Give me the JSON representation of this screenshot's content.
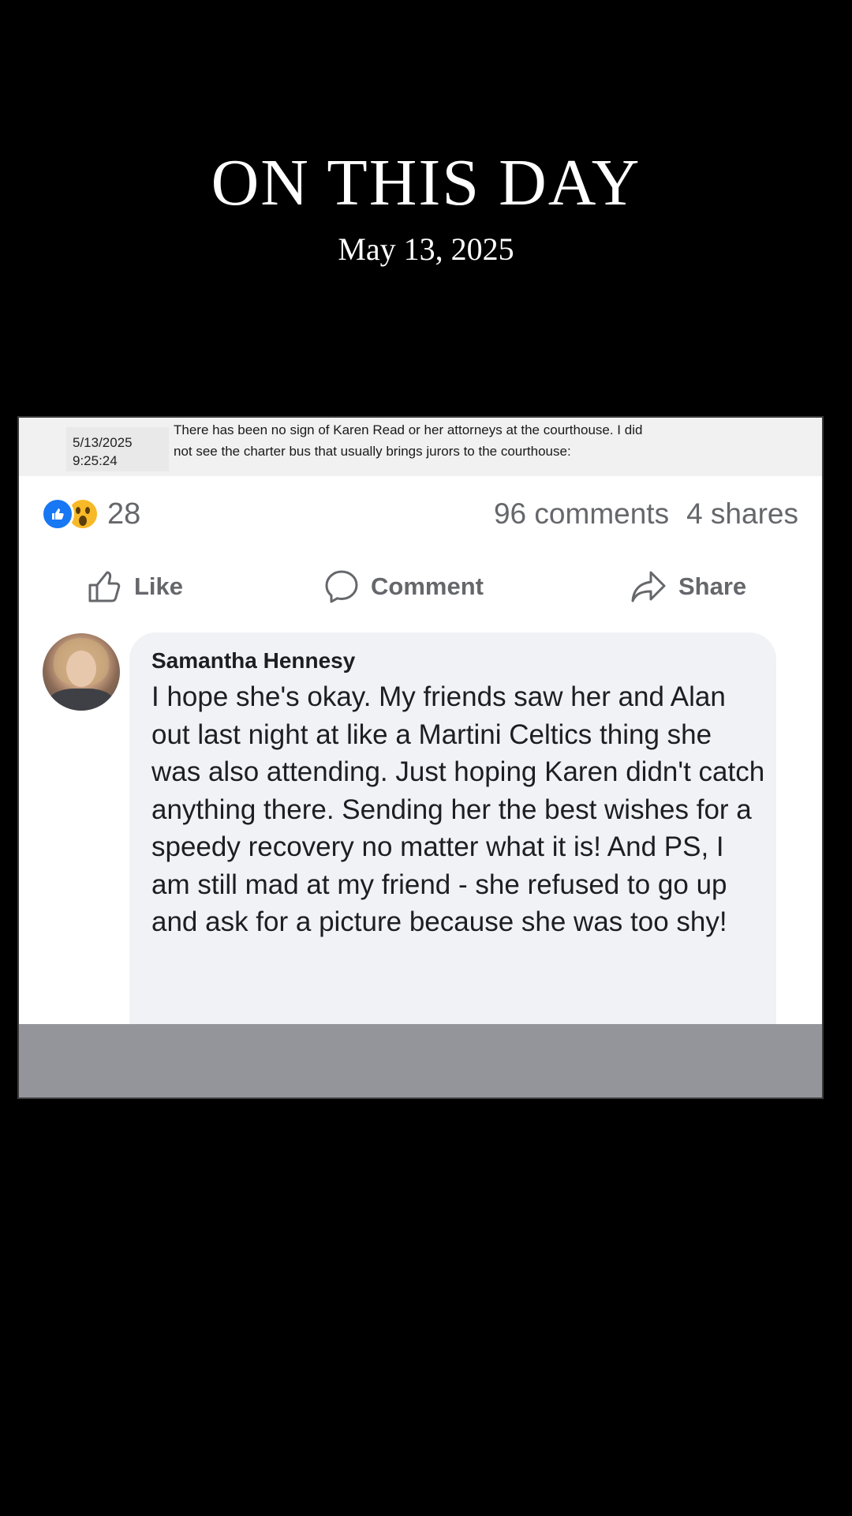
{
  "header": {
    "title": "ON THIS DAY",
    "date": "May 13, 2025"
  },
  "log": {
    "date": "5/13/2025",
    "time": "9:25:24",
    "text": "There has been no sign of Karen Read or her attorneys at the courthouse. I did not see the charter bus that usually brings jurors to the courthouse:"
  },
  "post": {
    "reactions": {
      "icons": [
        "like-reaction-icon",
        "wow-reaction-icon"
      ],
      "count": "28"
    },
    "comments_count": "96 comments",
    "shares_count": "4 shares",
    "actions": {
      "like_label": "Like",
      "comment_label": "Comment",
      "share_label": "Share"
    }
  },
  "comment": {
    "author": "Samantha Hennesy",
    "text": "I hope she's okay. My friends saw her and Alan out last night at like a Martini Celtics thing she was also attending. Just hoping Karen didn't catch anything there. Sending her the best wishes for a speedy recovery no matter what it is! And PS, I am still mad at my friend - she refused to go up and ask for a picture because she was too shy!"
  },
  "colors": {
    "background": "#000000",
    "facebook_blue": "#1877f2",
    "wow_yellow": "#f7b928",
    "muted_text": "#65676b",
    "comment_bubble": "#f0f2f5",
    "bottom_bar": "#94959b"
  }
}
